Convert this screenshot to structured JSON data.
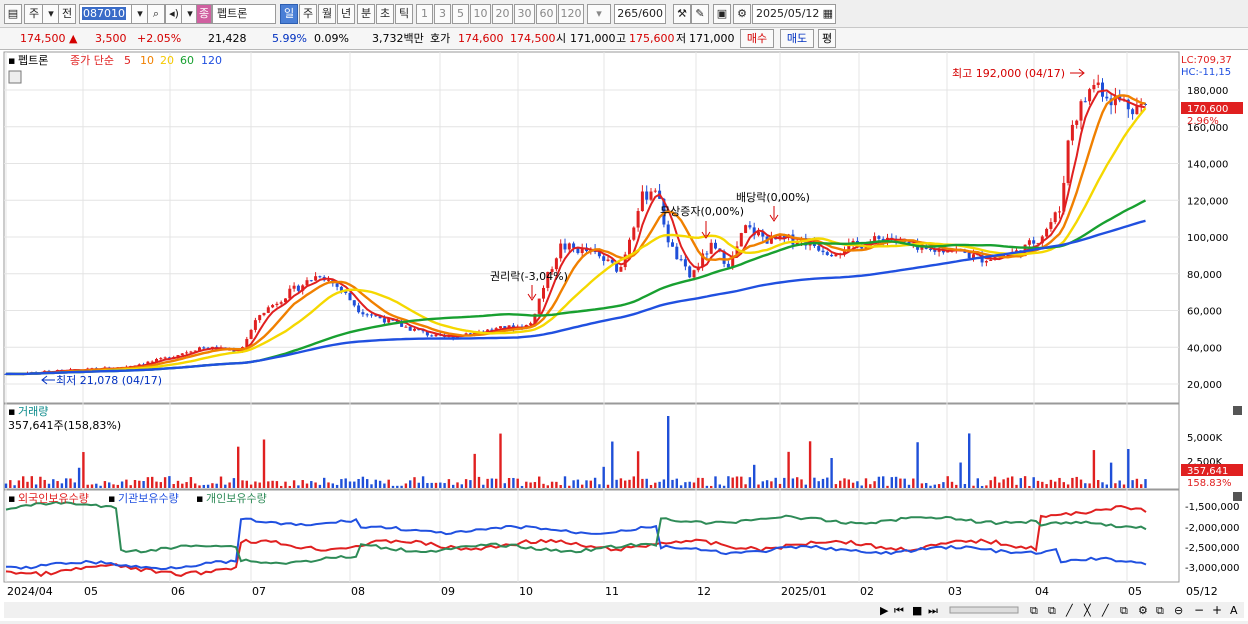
{
  "toolbar": {
    "period_jeon": "전",
    "period_ju": "주",
    "code": "087010",
    "type_badge": "종",
    "stock_name": "펩트론",
    "periods": [
      "일",
      "주",
      "월",
      "년",
      "분",
      "초",
      "틱"
    ],
    "intervals": [
      "1",
      "3",
      "5",
      "10",
      "20",
      "30",
      "60",
      "120"
    ],
    "count": "265",
    "count_total": "/600",
    "date": "2025/05/12"
  },
  "quote": {
    "price": "174,500",
    "change": "3,500",
    "change_pct": "+2.05%",
    "volume": "21,428",
    "turnover_pct": "5.99%",
    "pct2": "0.09%",
    "amount": "3,732백만",
    "hoga_label": "호가",
    "ask": "174,600",
    "bid": "174,500",
    "open_label": "시",
    "open": "171,000",
    "high_label": "고",
    "high": "175,600",
    "low_label": "저",
    "low": "171,000",
    "buy_button": "매수",
    "sell_button": "매도",
    "avg_button": "평"
  },
  "price_panel": {
    "name": "펩트론",
    "legend_prefix": "종가 단순",
    "ma_periods": [
      "5",
      "10",
      "20",
      "60",
      "120"
    ],
    "ma_colors": [
      "#e02020",
      "#f08000",
      "#f5d800",
      "#18a030",
      "#2050e0"
    ],
    "lc": "LC:709,37",
    "hc": "HC:-11,15",
    "current_price_tag": "170,600",
    "current_pct_tag": "2.96%",
    "high_note": "최고 192,000 (04/17)",
    "low_note": "최저 21,078 (04/17)",
    "events": [
      "권리락(-3,04%)",
      "무상증자(0,00%)",
      "배당락(0,00%)"
    ],
    "y_ticks": [
      "180,000",
      "160,000",
      "140,000",
      "120,000",
      "100,000",
      "80,000",
      "60,000",
      "40,000",
      "20,000"
    ]
  },
  "volume_panel": {
    "title": "거래량",
    "value": "357,641주(158,83%)",
    "y_ticks": [
      "5,000K",
      "2,500K"
    ],
    "tag_value": "357,641",
    "tag_pct": "158.83%"
  },
  "holdings_panel": {
    "legend": [
      "외국인보유수량",
      "기관보유수량",
      "개인보유수량"
    ],
    "y_ticks": [
      "-1,500,000",
      "-2,000,000",
      "-2,500,000",
      "-3,000,000"
    ]
  },
  "x_axis": [
    "2024/04",
    "05",
    "06",
    "07",
    "08",
    "09",
    "10",
    "11",
    "12",
    "2025/01",
    "02",
    "03",
    "04",
    "05"
  ],
  "x_axis_right": "05/12",
  "colors": {
    "up": "#e02020",
    "down": "#1f4fd8",
    "foreign": "#e02020",
    "inst": "#2050e0",
    "indiv": "#2e8b57"
  }
}
